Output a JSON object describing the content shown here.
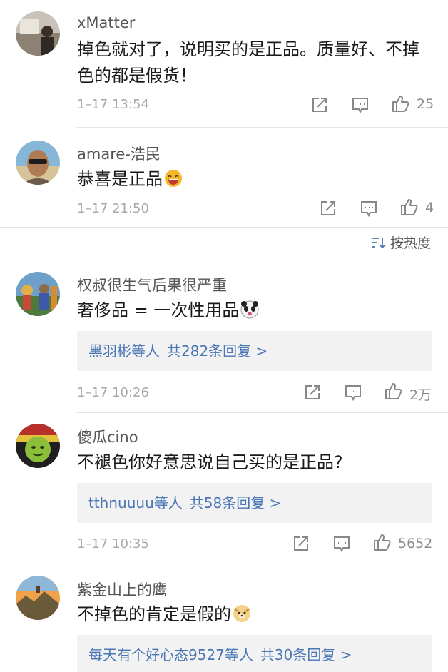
{
  "sort": {
    "label": "按热度"
  },
  "comments": [
    {
      "username": "xMatter",
      "text": "掉色就对了，说明买的是正品。质量好、不掉色的都是假货！",
      "time": "1–17 13:54",
      "likes": "25"
    },
    {
      "username": "amare-浩民",
      "text": "恭喜是正品",
      "emoji": "laughing-face-icon",
      "time": "1–17 21:50",
      "likes": "4"
    },
    {
      "username": "权叔很生气后果很严重",
      "text": "奢侈品 = 一次性用品",
      "emoji": "panda-face-icon",
      "replies": {
        "who": "黑羽彬等人",
        "count": "共282条回复 >"
      },
      "time": "1–17 10:26",
      "likes": "2万"
    },
    {
      "username": "傻瓜cino",
      "text": "不褪色你好意思说自己买的是正品?",
      "replies": {
        "who": "tthnuuuu等人",
        "count": "共58条回复 >"
      },
      "time": "1–17 10:35",
      "likes": "5652"
    },
    {
      "username": "紫金山上的鹰",
      "text": "不掉色的肯定是假的",
      "emoji": "doge-face-icon",
      "replies": {
        "who": "每天有个好心态9527等人",
        "count": "共30条回复 >"
      }
    }
  ],
  "colors": {
    "link": "#4a76b6",
    "meta": "#a8a8a8",
    "reply_bg": "#f2f2f2",
    "divider": "#e6e6e6"
  },
  "icons": [
    "share-icon",
    "comment-icon",
    "like-icon",
    "sort-icon"
  ]
}
